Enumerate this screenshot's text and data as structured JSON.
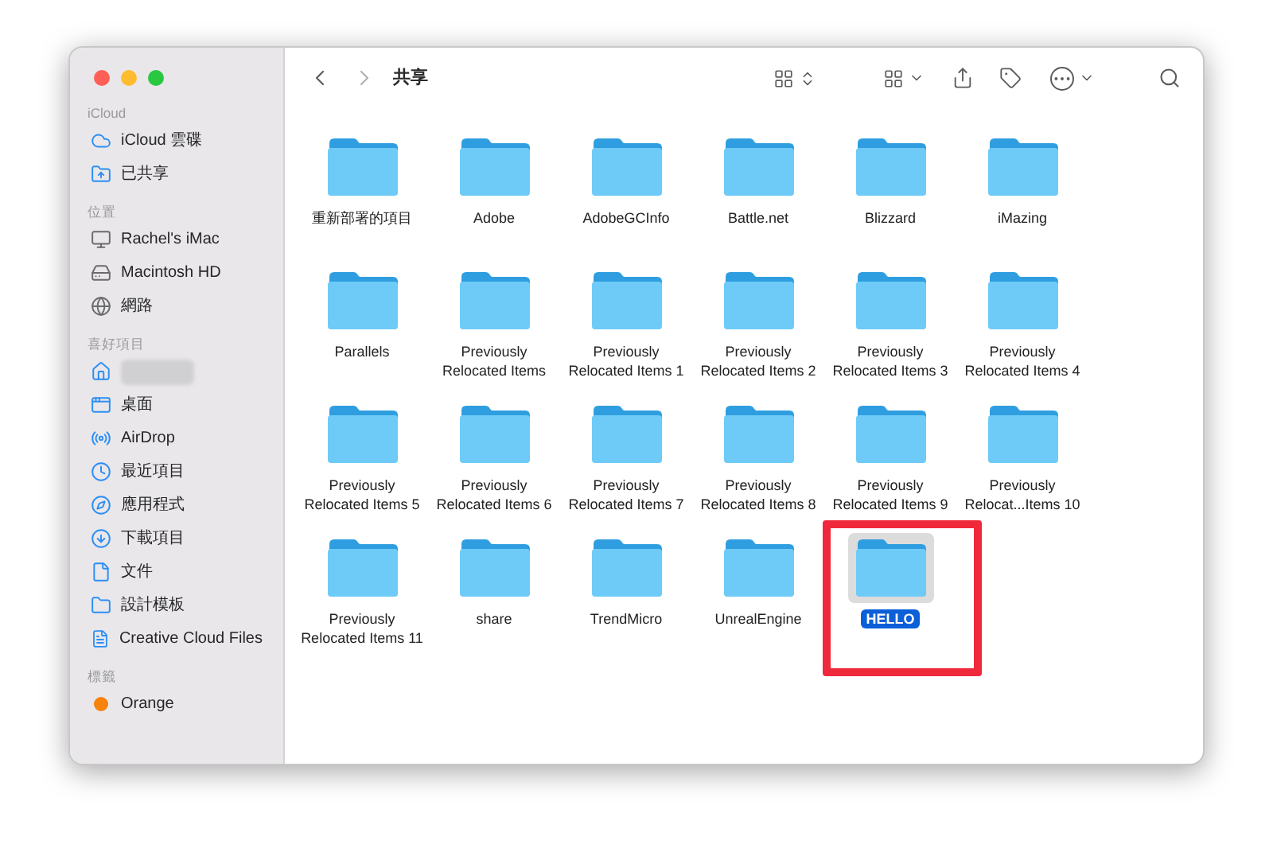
{
  "window": {
    "title": "共享"
  },
  "sidebar": {
    "sections": [
      {
        "heading": "iCloud",
        "items": [
          {
            "kind": "item",
            "label": "iCloud 雲碟"
          },
          {
            "kind": "item",
            "label": "已共享"
          }
        ]
      },
      {
        "heading": "位置",
        "items": [
          {
            "kind": "item",
            "label": "Rachel's iMac"
          },
          {
            "kind": "item",
            "label": "Macintosh HD"
          },
          {
            "kind": "item",
            "label": "網路"
          }
        ]
      },
      {
        "heading": "喜好項目",
        "items": [
          {
            "kind": "redacted"
          },
          {
            "kind": "item",
            "label": "桌面"
          },
          {
            "kind": "item",
            "label": "AirDrop"
          },
          {
            "kind": "item",
            "label": "最近項目"
          },
          {
            "kind": "item",
            "label": "應用程式"
          },
          {
            "kind": "item",
            "label": "下載項目"
          },
          {
            "kind": "item",
            "label": "文件"
          },
          {
            "kind": "item",
            "label": "設計模板"
          },
          {
            "kind": "item",
            "label": "Creative Cloud Files"
          }
        ]
      },
      {
        "heading": "標籤",
        "items": [
          {
            "kind": "tag",
            "label": "Orange",
            "color": "#f7820c"
          }
        ]
      }
    ]
  },
  "folders": [
    {
      "name": "重新部署的項目",
      "selected": false,
      "annotated": false
    },
    {
      "name": "Adobe",
      "selected": false,
      "annotated": false
    },
    {
      "name": "AdobeGCInfo",
      "selected": false,
      "annotated": false
    },
    {
      "name": "Battle.net",
      "selected": false,
      "annotated": false
    },
    {
      "name": "Blizzard",
      "selected": false,
      "annotated": false
    },
    {
      "name": "iMazing",
      "selected": false,
      "annotated": false
    },
    {
      "name": "Parallels",
      "selected": false,
      "annotated": false
    },
    {
      "name": "Previously Relocated Items",
      "selected": false,
      "annotated": false
    },
    {
      "name": "Previously Relocated Items 1",
      "selected": false,
      "annotated": false
    },
    {
      "name": "Previously Relocated Items 2",
      "selected": false,
      "annotated": false
    },
    {
      "name": "Previously Relocated Items 3",
      "selected": false,
      "annotated": false
    },
    {
      "name": "Previously Relocated Items 4",
      "selected": false,
      "annotated": false
    },
    {
      "name": "Previously Relocated Items 5",
      "selected": false,
      "annotated": false
    },
    {
      "name": "Previously Relocated Items 6",
      "selected": false,
      "annotated": false
    },
    {
      "name": "Previously Relocated Items 7",
      "selected": false,
      "annotated": false
    },
    {
      "name": "Previously Relocated Items 8",
      "selected": false,
      "annotated": false
    },
    {
      "name": "Previously Relocated Items 9",
      "selected": false,
      "annotated": false
    },
    {
      "name": "Previously Relocat...Items 10",
      "selected": false,
      "annotated": false
    },
    {
      "name": "Previously Relocated Items 11",
      "selected": false,
      "annotated": false
    },
    {
      "name": "share",
      "selected": false,
      "annotated": false
    },
    {
      "name": "TrendMicro",
      "selected": false,
      "annotated": false
    },
    {
      "name": "UnrealEngine",
      "selected": false,
      "annotated": false
    },
    {
      "name": "HELLO",
      "selected": true,
      "annotated": true
    }
  ]
}
